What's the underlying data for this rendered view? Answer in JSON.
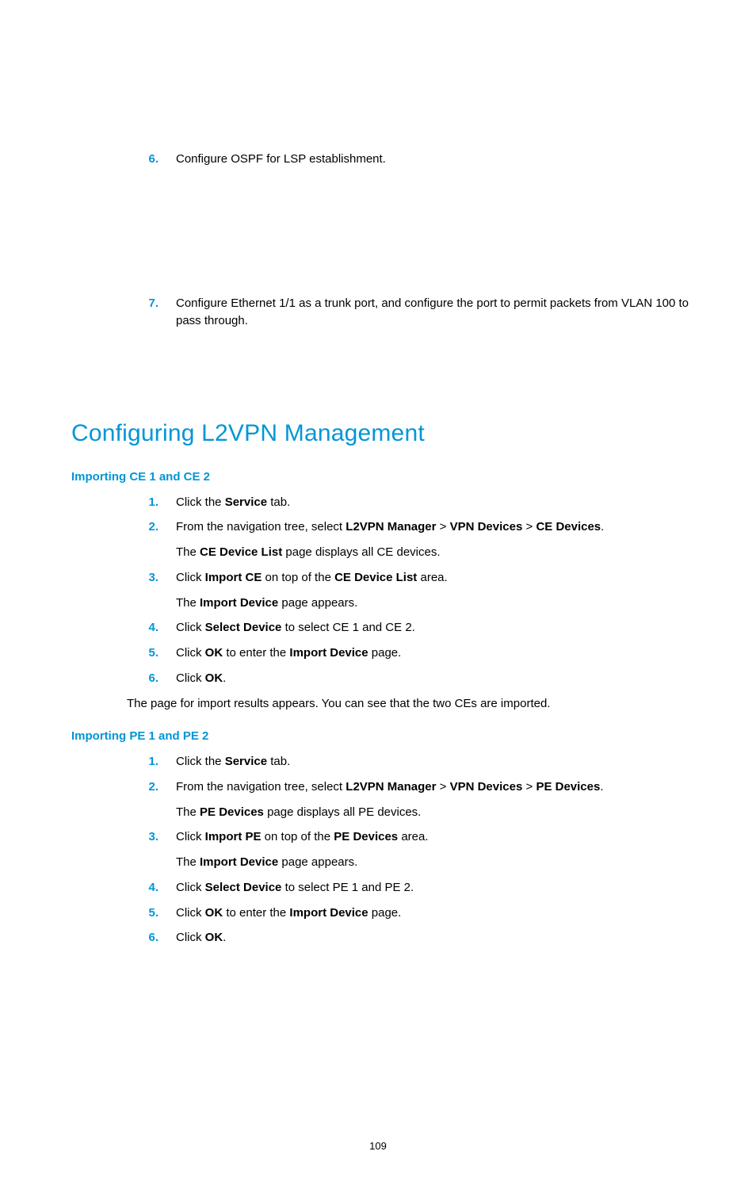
{
  "top_steps": [
    {
      "num": "6.",
      "text": "Configure OSPF for LSP establishment."
    },
    {
      "num": "7.",
      "text": "Configure Ethernet 1/1 as a trunk port, and configure the port to permit packets from VLAN 100 to pass through."
    }
  ],
  "section_title": "Configuring L2VPN Management",
  "ce": {
    "heading": "Importing CE 1 and CE 2",
    "steps": [
      {
        "num": "1.",
        "parts": [
          "Click the ",
          "Service",
          " tab."
        ]
      },
      {
        "num": "2.",
        "parts": [
          "From the navigation tree, select ",
          "L2VPN Manager",
          " > ",
          "VPN Devices",
          " > ",
          "CE Devices",
          "."
        ],
        "follow_parts": [
          "The ",
          "CE Device List",
          " page displays all CE devices."
        ]
      },
      {
        "num": "3.",
        "parts": [
          "Click ",
          "Import CE",
          " on top of the ",
          "CE Device List",
          " area."
        ],
        "follow_parts": [
          "The ",
          "Import Device",
          " page appears."
        ]
      },
      {
        "num": "4.",
        "parts": [
          "Click ",
          "Select Device",
          " to select CE 1 and CE 2."
        ]
      },
      {
        "num": "5.",
        "parts": [
          "Click ",
          "OK",
          " to enter the ",
          "Import Device",
          " page."
        ]
      },
      {
        "num": "6.",
        "parts": [
          "Click ",
          "OK",
          "."
        ]
      }
    ],
    "after": "The page for import results appears. You can see that the two CEs are imported."
  },
  "pe": {
    "heading": "Importing PE 1 and PE 2",
    "steps": [
      {
        "num": "1.",
        "parts": [
          "Click the ",
          "Service",
          " tab."
        ]
      },
      {
        "num": "2.",
        "parts": [
          "From the navigation tree, select ",
          "L2VPN Manager",
          " > ",
          "VPN Devices",
          " > ",
          "PE Devices",
          "."
        ],
        "follow_parts": [
          "The ",
          "PE Devices",
          " page displays all PE devices."
        ]
      },
      {
        "num": "3.",
        "parts": [
          "Click ",
          "Import PE",
          " on top of the ",
          "PE Devices",
          " area."
        ],
        "follow_parts": [
          "The ",
          "Import Device",
          " page appears."
        ]
      },
      {
        "num": "4.",
        "parts": [
          "Click ",
          "Select Device",
          " to select PE 1 and PE 2."
        ]
      },
      {
        "num": "5.",
        "parts": [
          "Click ",
          "OK",
          " to enter the ",
          "Import Device",
          " page."
        ]
      },
      {
        "num": "6.",
        "parts": [
          "Click ",
          "OK",
          "."
        ]
      }
    ]
  },
  "page_number": "109"
}
